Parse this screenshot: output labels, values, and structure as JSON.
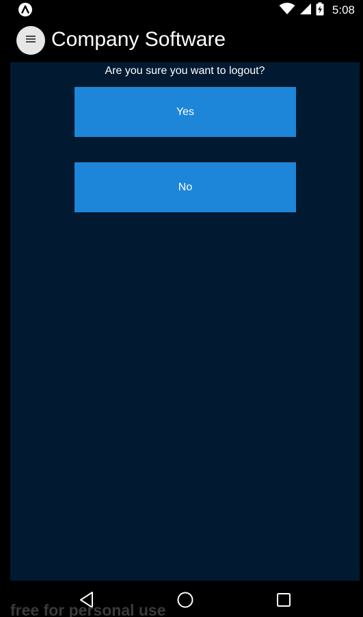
{
  "status_bar": {
    "time": "5:08",
    "icons": [
      "app-notification-icon",
      "wifi-icon",
      "signal-icon",
      "battery-charging-icon"
    ]
  },
  "app_bar": {
    "menu_icon": "hamburger-menu-icon",
    "title": "Company Software"
  },
  "dialog": {
    "prompt": "Are you sure you want to logout?",
    "yes_label": "Yes",
    "no_label": "No"
  },
  "nav_bar": {
    "icons": [
      "back-icon",
      "home-icon",
      "recents-icon"
    ]
  },
  "watermark": "free for personal use",
  "colors": {
    "background": "#000000",
    "panel": "#011a31",
    "button": "#1e86d9",
    "text": "#ffffff",
    "menu_button": "#e6e6e6"
  }
}
